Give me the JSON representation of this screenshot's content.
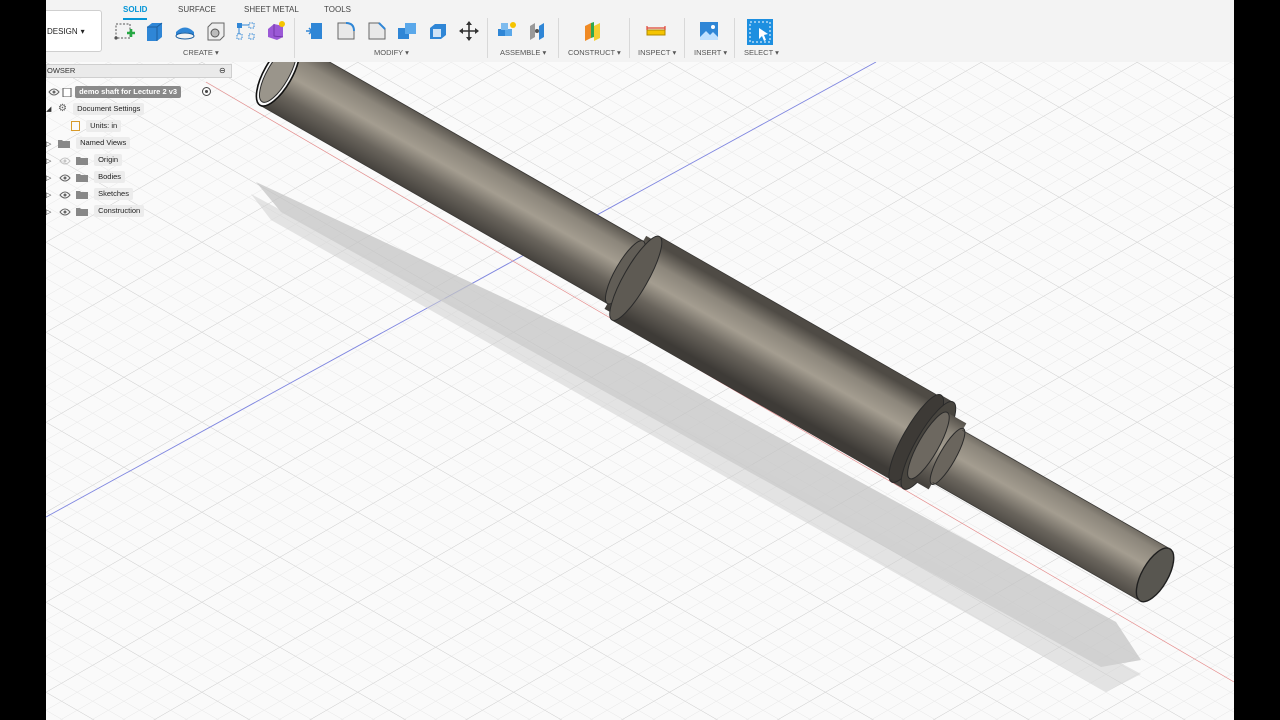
{
  "workspace": {
    "label": "DESIGN",
    "caret": "▾"
  },
  "tabs": [
    {
      "label": "SOLID",
      "active": true
    },
    {
      "label": "SURFACE",
      "active": false
    },
    {
      "label": "SHEET METAL",
      "active": false
    },
    {
      "label": "TOOLS",
      "active": false
    }
  ],
  "groups": {
    "create": "CREATE ▾",
    "modify": "MODIFY ▾",
    "assemble": "ASSEMBLE ▾",
    "construct": "CONSTRUCT ▾",
    "inspect": "INSPECT ▾",
    "insert": "INSERT ▾",
    "select": "SELECT ▾"
  },
  "tools": {
    "create": [
      "create-sketch-icon",
      "extrude-icon",
      "revolve-icon",
      "hole-icon",
      "pattern-icon",
      "create-form-icon"
    ],
    "modify": [
      "press-pull-icon",
      "fillet-icon",
      "chamfer-icon",
      "combine-icon",
      "shell-icon",
      "move-icon"
    ],
    "assemble": [
      "new-component-icon",
      "joint-icon"
    ],
    "construct": [
      "offset-plane-icon"
    ],
    "inspect": [
      "measure-icon"
    ],
    "insert": [
      "insert-image-icon"
    ],
    "select": [
      "select-icon"
    ]
  },
  "browser": {
    "title": "OWSER",
    "document": "demo shaft for Lecture 2 v3",
    "items": [
      {
        "label": "Document Settings"
      },
      {
        "label": "Units: in"
      },
      {
        "label": "Named Views"
      },
      {
        "label": "Origin"
      },
      {
        "label": "Bodies"
      },
      {
        "label": "Sketches"
      },
      {
        "label": "Construction"
      }
    ]
  },
  "colors": {
    "accent": "#0696d7",
    "shaft": "#6f6a62",
    "grid": "#e3e3e3"
  }
}
